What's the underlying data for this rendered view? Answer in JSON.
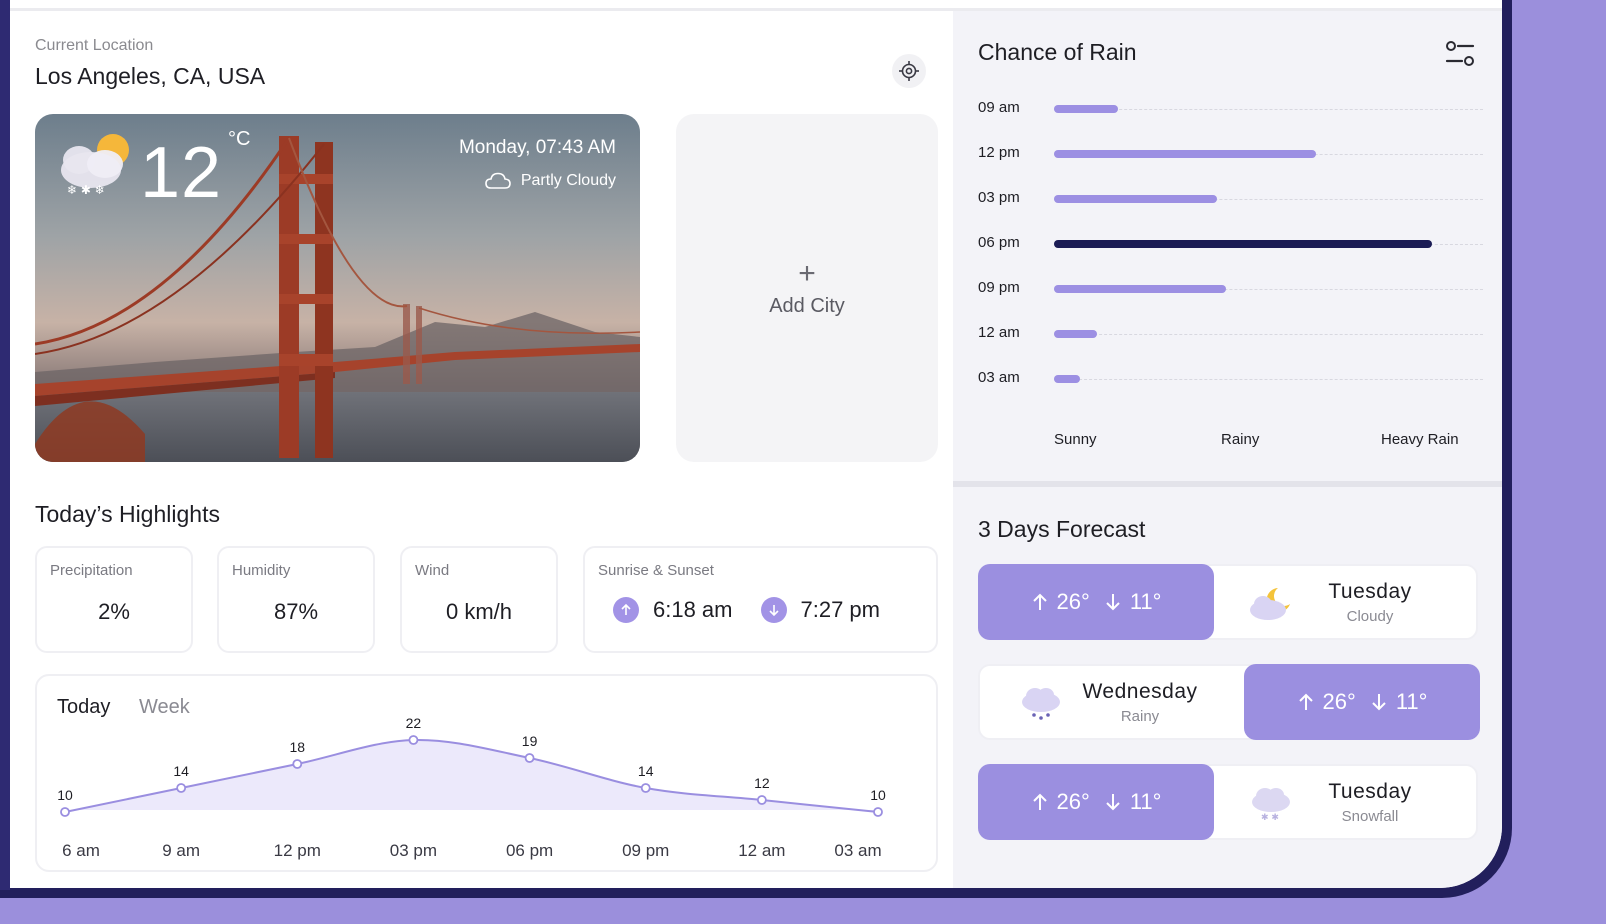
{
  "location": {
    "caption": "Current Location",
    "city": "Los Angeles, CA, USA"
  },
  "hero": {
    "temperature": "12",
    "unit": "°C",
    "datetime": "Monday, 07:43 AM",
    "condition": "Partly Cloudy"
  },
  "add_city": {
    "plus": "+",
    "label": "Add City"
  },
  "highlights": {
    "title": "Today’s Highlights",
    "precipitation": {
      "label": "Precipitation",
      "value": "2%"
    },
    "humidity": {
      "label": "Humidity",
      "value": "87%"
    },
    "wind": {
      "label": "Wind",
      "value": "0 km/h"
    },
    "sun": {
      "label": "Sunrise & Sunset",
      "sunrise": "6:18 am",
      "sunset": "7:27 pm"
    }
  },
  "temp_chart": {
    "tabs": [
      "Today",
      "Week"
    ],
    "active_tab": "Today"
  },
  "chart_data": {
    "type": "area",
    "categories": [
      "6 am",
      "9 am",
      "12 pm",
      "03 pm",
      "06 pm",
      "09 pm",
      "12 am",
      "03 am"
    ],
    "series": [
      {
        "values": [
          10,
          14,
          18,
          22,
          19,
          14,
          12,
          10
        ]
      }
    ],
    "data_labels": [
      "10",
      "14",
      "18",
      "22",
      "19",
      "14",
      "12",
      "10"
    ],
    "title": "",
    "xlabel": "",
    "ylabel": "",
    "ylim": [
      8,
      26
    ],
    "grid": false,
    "line_color": "#9a8ee0",
    "fill_color": "#ece9fb"
  },
  "rain": {
    "title": "Chance of Rain",
    "scale": [
      "Sunny",
      "Rainy",
      "Heavy Rain"
    ],
    "rows": [
      {
        "time": "09 am",
        "level": 0.15
      },
      {
        "time": "12 pm",
        "level": 0.61
      },
      {
        "time": "03 pm",
        "level": 0.38
      },
      {
        "time": "06 pm",
        "level": 0.88
      },
      {
        "time": "09 pm",
        "level": 0.4
      },
      {
        "time": "12 am",
        "level": 0.1
      },
      {
        "time": "03 am",
        "level": 0.06
      }
    ],
    "highlight_time": "06 pm",
    "bar_color": "#9c8fe3",
    "highlight_color": "#1b1c55"
  },
  "forecast": {
    "title": "3 Days Forecast",
    "days": [
      {
        "high": "26°",
        "low": "11°",
        "day": "Tuesday",
        "condition": "Cloudy"
      },
      {
        "high": "26°",
        "low": "11°",
        "day": "Wednesday",
        "condition": "Rainy"
      },
      {
        "high": "26°",
        "low": "11°",
        "day": "Tuesday",
        "condition": "Snowfall"
      }
    ]
  },
  "colors": {
    "accent": "#9b8fe0",
    "background": "#9b8fdc",
    "frame": "#221f5c"
  }
}
